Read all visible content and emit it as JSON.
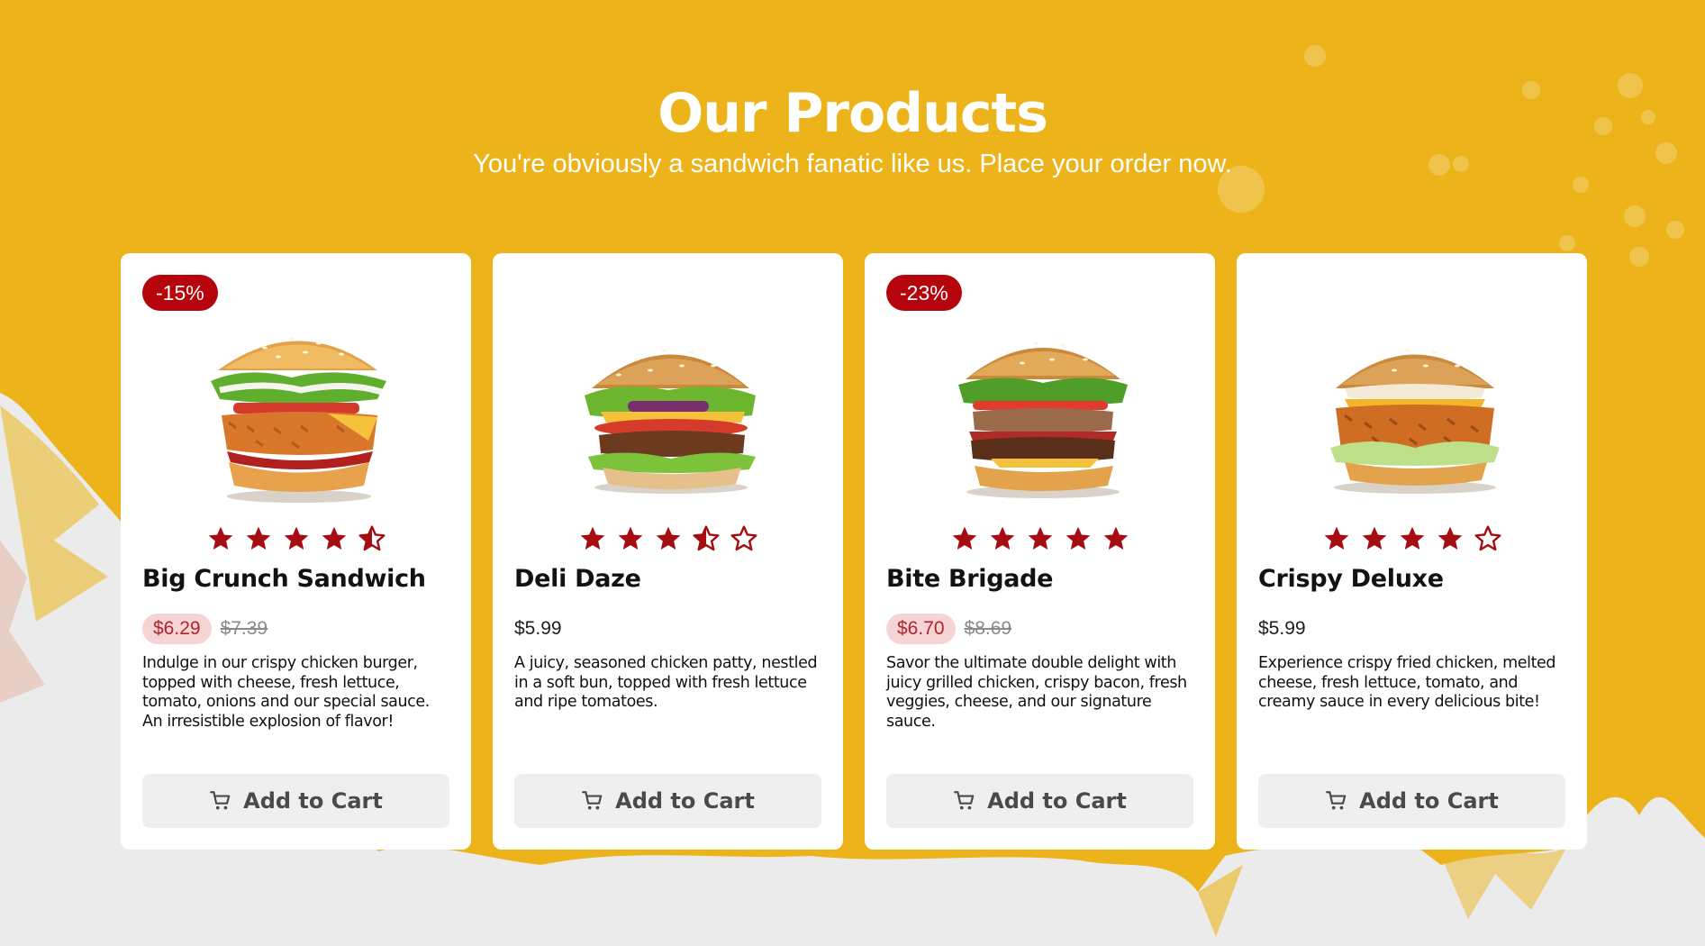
{
  "header": {
    "title": "Our Products",
    "subtitle": "You're obviously a sandwich fanatic like us. Place your order now."
  },
  "colors": {
    "background_yellow": "#ecb41a",
    "accent_red": "#b5040b",
    "sale_pill_bg": "#f6d4d6",
    "button_bg": "#efefef"
  },
  "products": [
    {
      "badge": "-15%",
      "name": "Big Crunch Sandwich",
      "rating": 4.5,
      "price": "$6.29",
      "old_price": "$7.39",
      "description": "Indulge in our crispy chicken burger, topped with cheese, fresh lettuce, tomato, onions and our special sauce. An irresistible explosion of flavor!",
      "button_label": "Add to Cart",
      "icon": "cart-icon"
    },
    {
      "badge": "",
      "name": "Deli Daze",
      "rating": 3.5,
      "price": "$5.99",
      "old_price": "",
      "description": "A juicy, seasoned chicken patty, nestled in a soft bun, topped with fresh lettuce and ripe tomatoes.",
      "button_label": "Add to Cart",
      "icon": "cart-icon"
    },
    {
      "badge": "-23%",
      "name": "Bite Brigade",
      "rating": 5,
      "price": "$6.70",
      "old_price": "$8.69",
      "description": "Savor the ultimate double delight with juicy grilled chicken, crispy bacon, fresh veggies, cheese, and our signature sauce.",
      "button_label": "Add to Cart",
      "icon": "cart-icon"
    },
    {
      "badge": "",
      "name": "Crispy Deluxe",
      "rating": 4,
      "price": "$5.99",
      "old_price": "",
      "description": "Experience crispy fried chicken, melted cheese, fresh lettuce, tomato, and creamy sauce in every delicious bite!",
      "button_label": "Add to Cart",
      "icon": "cart-icon"
    }
  ]
}
